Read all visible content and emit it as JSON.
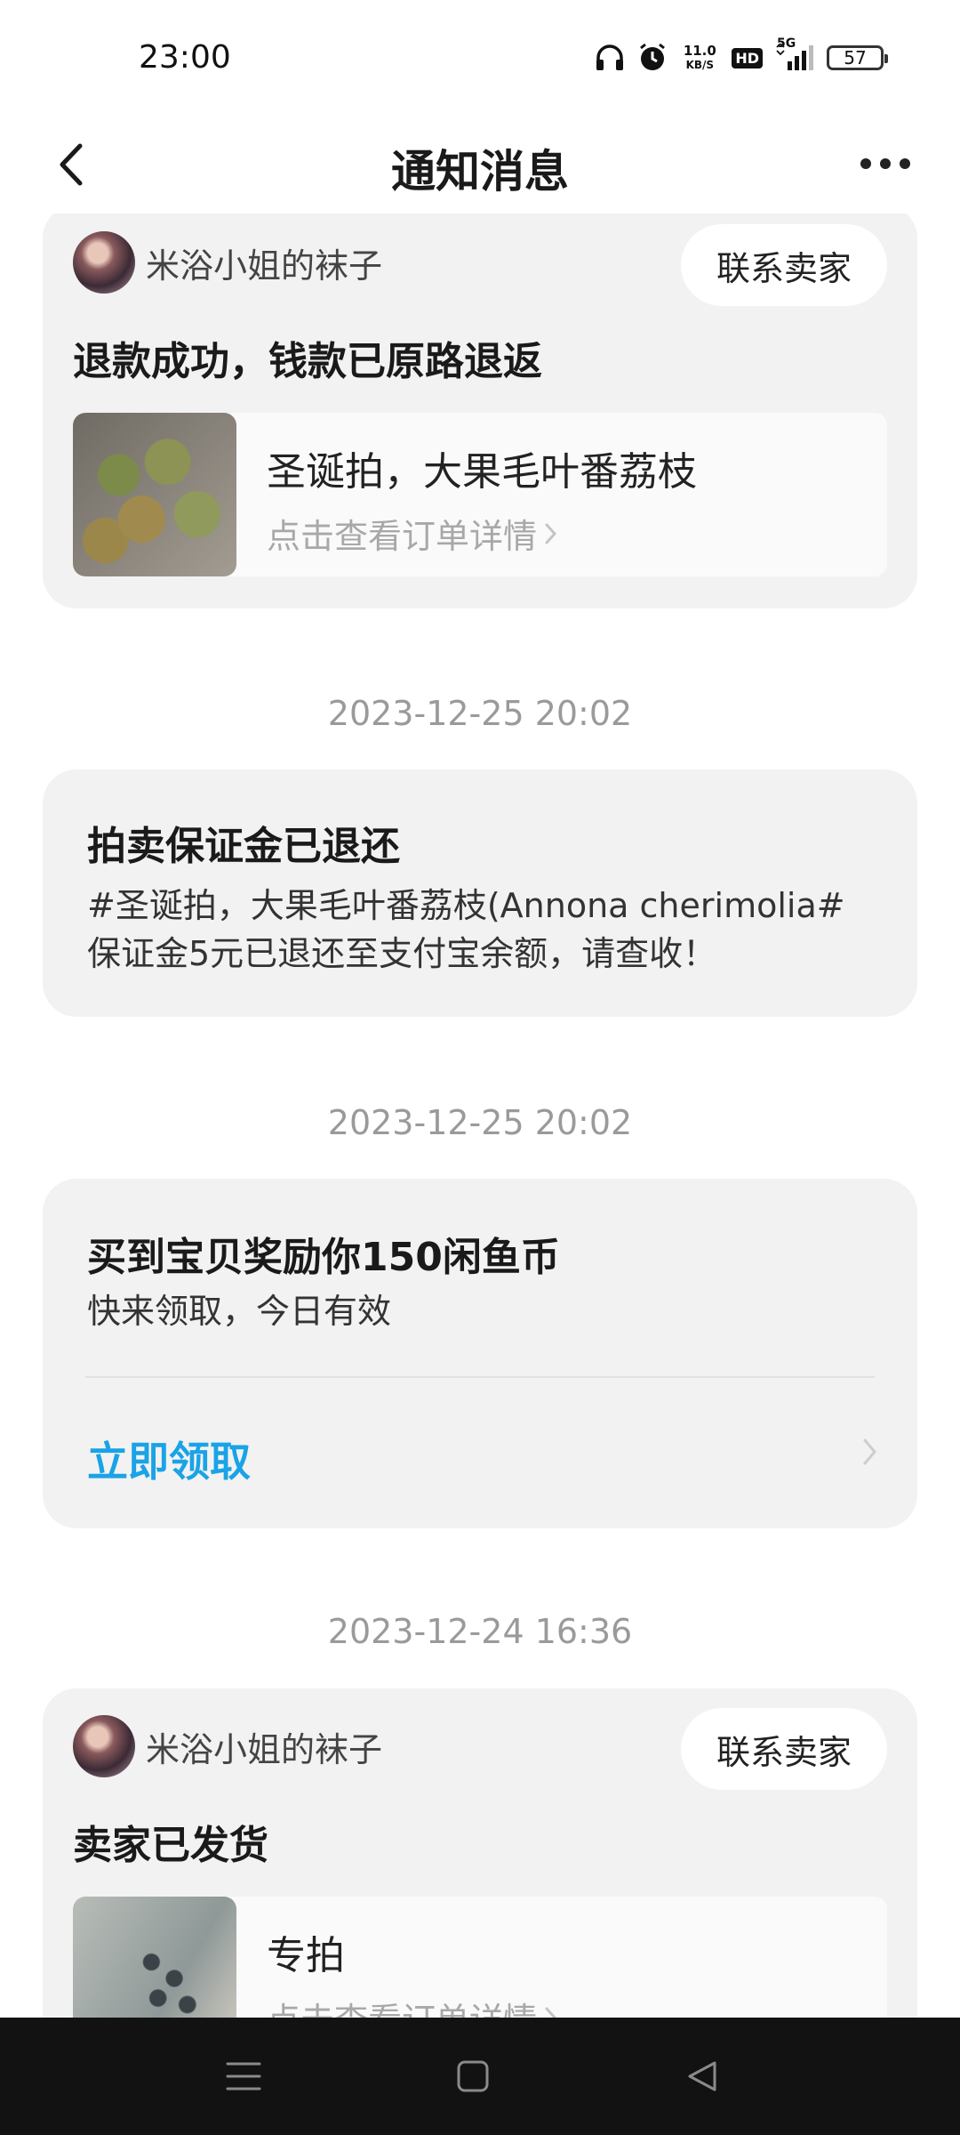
{
  "status_bar": {
    "time": "23:00",
    "net_speed_value": "11.0",
    "net_speed_unit": "KB/S",
    "hd_label": "HD",
    "network_type": "5G",
    "battery": "57",
    "icons": [
      "headphones-icon",
      "alarm-icon",
      "hd-icon",
      "signal-icon",
      "battery-icon"
    ]
  },
  "nav": {
    "title": "通知消息",
    "back_icon": "chevron-left-icon",
    "more_icon": "more-dots-icon"
  },
  "messages": [
    {
      "seller": "米浴小姐的袜子",
      "contact_label": "联系卖家",
      "title": "退款成功，钱款已原路退返",
      "item_name": "圣诞拍，大果毛叶番荔枝",
      "detail_link": "点击查看订单详情"
    },
    {
      "time": "2023-12-25 20:02",
      "title": "拍卖保证金已退还",
      "body_line1": "#圣诞拍，大果毛叶番荔枝(Annona cherimolia#",
      "body_line2": "保证金5元已退还至支付宝余额，请查收！"
    },
    {
      "time": "2023-12-25 20:02",
      "title": "买到宝贝奖励你150闲鱼币",
      "body": "快来领取，今日有效",
      "action_label": "立即领取"
    },
    {
      "time": "2023-12-24 16:36",
      "seller": "米浴小姐的袜子",
      "contact_label": "联系卖家",
      "title": "卖家已发货",
      "item_name": "专拍",
      "detail_link": "点击查看订单详情"
    }
  ],
  "colors": {
    "card_bg": "#f2f2f2",
    "accent_link": "#1aa3e6",
    "timestamp": "#9a9a9a",
    "system_nav_bg": "#121212"
  },
  "system_nav": {
    "icons": [
      "menu-icon",
      "home-square-icon",
      "back-triangle-icon"
    ]
  }
}
